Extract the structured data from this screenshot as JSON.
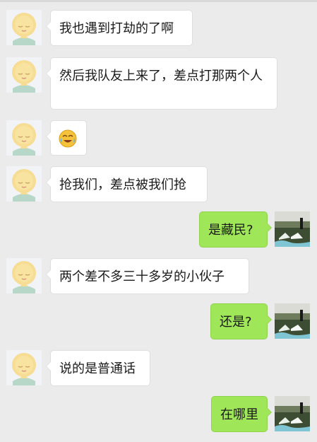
{
  "colors": {
    "background": "#ebebeb",
    "incoming_bubble": "#ffffff",
    "outgoing_bubble": "#9fe658",
    "text": "#1a1a1a"
  },
  "messages": [
    {
      "side": "left",
      "type": "text",
      "text": "我也遇到打劫的了啊"
    },
    {
      "side": "left",
      "type": "text",
      "text": "然后我队友上来了，差点打那两个人"
    },
    {
      "side": "left",
      "type": "emoji",
      "emoji": "laugh-cry-emoji"
    },
    {
      "side": "left",
      "type": "text",
      "text": "抢我们，差点被我们抢"
    },
    {
      "side": "right",
      "type": "text",
      "text": "是藏民?"
    },
    {
      "side": "left",
      "type": "text",
      "text": "两个差不多三十多岁的小伙子"
    },
    {
      "side": "right",
      "type": "text",
      "text": "还是?"
    },
    {
      "side": "left",
      "type": "text",
      "text": "说的是普通话"
    },
    {
      "side": "right",
      "type": "text",
      "text": "在哪里"
    }
  ]
}
